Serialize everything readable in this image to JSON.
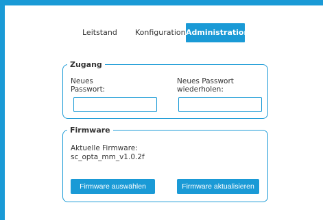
{
  "nav": {
    "tabs": [
      {
        "label": "Leitstand"
      },
      {
        "label": "Konfiguration"
      },
      {
        "label": "Administration"
      }
    ]
  },
  "zugang": {
    "legend": "Zugang",
    "new_password_label": "Neues\nPasswort:",
    "repeat_password_label": "Neues Passwort\nwiederholen:",
    "new_password_value": "",
    "repeat_password_value": ""
  },
  "firmware": {
    "legend": "Firmware",
    "current_label": "Aktuelle Firmware:",
    "current_version": "sc_opta_mm_v1.0.2f",
    "select_button": "Firmware auswählen",
    "update_button": "Firmware aktualisieren"
  },
  "colors": {
    "accent": "#1a9ad6"
  }
}
